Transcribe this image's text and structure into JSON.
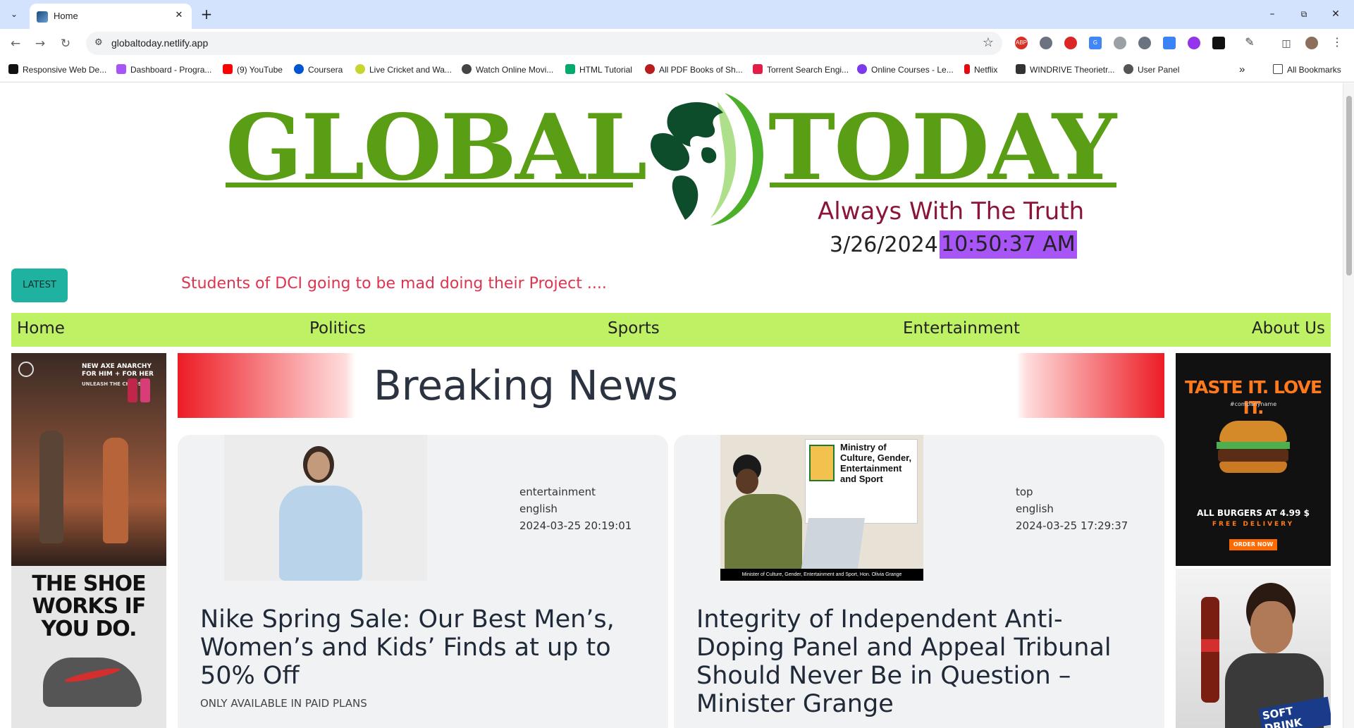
{
  "browser": {
    "tab_title": "Home",
    "url": "globaltoday.netlify.app",
    "bookmarks": [
      {
        "label": "Responsive Web De...",
        "color": "#111111"
      },
      {
        "label": "Dashboard - Progra...",
        "color": "#a855f7"
      },
      {
        "label": "(9) YouTube",
        "color": "#ff0000"
      },
      {
        "label": "Coursera",
        "color": "#0056d2"
      },
      {
        "label": "Live Cricket and Wa...",
        "color": "#c7d62f"
      },
      {
        "label": "Watch Online Movi...",
        "color": "#444444"
      },
      {
        "label": "HTML Tutorial",
        "color": "#04aa6d"
      },
      {
        "label": "All PDF Books of Sh...",
        "color": "#b91c1c"
      },
      {
        "label": "Torrent Search Engi...",
        "color": "#e11d48"
      },
      {
        "label": "Online Courses - Le...",
        "color": "#7c3aed"
      },
      {
        "label": "Netflix",
        "color": "#e50914"
      },
      {
        "label": "WINDRIVE Theorietr...",
        "color": "#333333"
      },
      {
        "label": "User Panel",
        "color": "#555555"
      }
    ],
    "all_bookmarks_label": "All Bookmarks"
  },
  "header": {
    "logo_left": "GLOBAL",
    "logo_right": "TODAY",
    "tagline": "Always With The Truth",
    "date": "3/26/2024",
    "time": "10:50:37 AM"
  },
  "latest": {
    "button_label": "LATEST",
    "ticker_text": "Students of DCI going to be mad doing their Project ...."
  },
  "nav": {
    "items": [
      "Home",
      "Politics",
      "Sports",
      "Entertainment",
      "About Us"
    ]
  },
  "breaking_title": "Breaking News",
  "ads": {
    "left_top_text": "NEW AXE ANARCHY FOR HIM + FOR HER",
    "left_top_sub": "UNLEASH THE CHAOS",
    "left_bottom_text": "THE SHOE WORKS IF YOU DO.",
    "right_top_headline": "TASTE IT. LOVE IT.",
    "right_top_tag": "#companyname",
    "right_top_price": "ALL BURGERS AT 4.99 $",
    "right_top_delivery": "FREE DELIVERY",
    "right_top_cta": "ORDER NOW",
    "right_bottom_text": "SOFT DRINK"
  },
  "cards": [
    {
      "category": "entertainment",
      "language": "english",
      "published": "2024-03-25 20:19:01",
      "title": "Nike Spring Sale: Our Best Men’s, Women’s and Kids’ Finds at up to 50% Off",
      "note": "ONLY AVAILABLE IN PAID PLANS"
    },
    {
      "category": "top",
      "language": "english",
      "published": "2024-03-25 17:29:37",
      "title": "Integrity of Independent Anti-Doping Panel and Appeal Tribunal Should Never Be in Question – Minister Grange",
      "image_caption": "Minister of Culture, Gender, Entertainment and Sport, Hon. Olivia Grange",
      "image_sign": "Ministry of Culture, Gender, Entertainment and Sport"
    }
  ]
}
